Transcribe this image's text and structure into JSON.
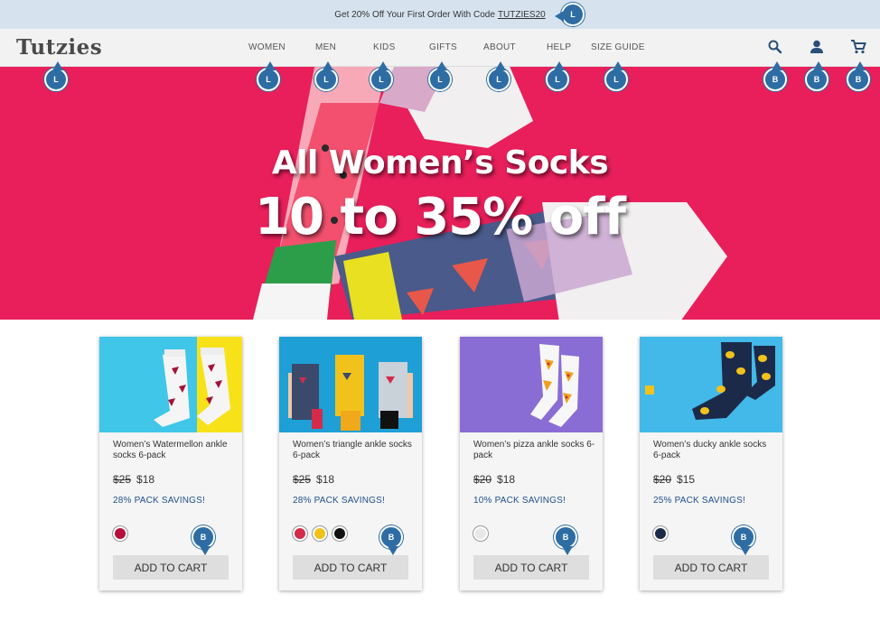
{
  "promo": {
    "text": "Get 20% Off Your First Order With Code",
    "code": "TUTZIES20"
  },
  "header": {
    "logo": "Tutzies",
    "nav": [
      "WOMEN",
      "MEN",
      "KIDS",
      "GIFTS",
      "ABOUT",
      "HELP",
      "SIZE GUIDE"
    ],
    "icons": [
      "search-icon",
      "account-icon",
      "cart-icon"
    ]
  },
  "hero": {
    "title": "All Women’s Socks",
    "subtitle": "10 to 35% off",
    "bg_color": "#e81f5b"
  },
  "products": [
    {
      "name": "Women’s Watermellon ankle socks 6-pack",
      "old_price": "$25",
      "price": "$18",
      "savings": "28% PACK SAVINGS!",
      "button": "ADD TO CART",
      "colors": [
        "#b5103a"
      ]
    },
    {
      "name": "Women’s triangle ankle socks 6-pack",
      "old_price": "$25",
      "price": "$18",
      "savings": "28% PACK SAVINGS!",
      "button": "ADD TO CART",
      "colors": [
        "#d42b4a",
        "#f1c21b",
        "#111111"
      ]
    },
    {
      "name": "Women’s pizza ankle socks 6-pack",
      "old_price": "$20",
      "price": "$18",
      "savings": "10% PACK SAVINGS!",
      "button": "ADD TO CART",
      "colors": [
        "#e8e8e8"
      ]
    },
    {
      "name": "Women’s ducky ankle socks 6-pack",
      "old_price": "$20",
      "price": "$15",
      "savings": "25% PACK SAVINGS!",
      "button": "ADD TO CART",
      "colors": [
        "#1c2a4a"
      ]
    }
  ],
  "annotations": {
    "link": "L",
    "button": "B"
  }
}
